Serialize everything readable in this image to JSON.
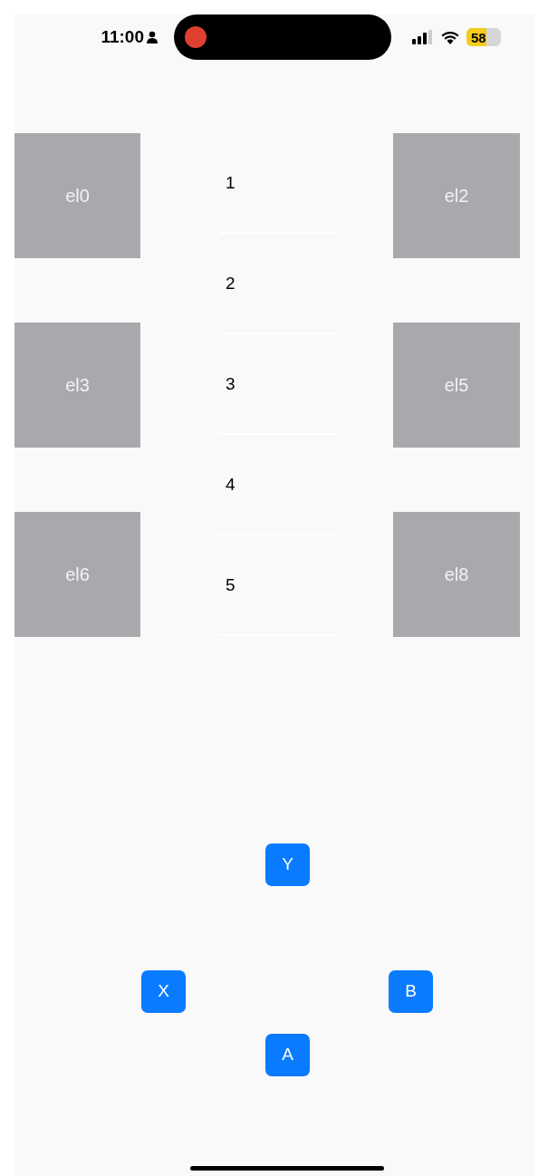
{
  "status_bar": {
    "time": "11:00",
    "battery": "58"
  },
  "tile_rows": [
    {
      "left": "el0",
      "right": "el2"
    },
    {
      "left": "el3",
      "right": "el5"
    },
    {
      "left": "el6",
      "right": "el8"
    }
  ],
  "list_items": [
    "1",
    "2",
    "3",
    "4",
    "5"
  ],
  "pad_buttons": [
    {
      "label": "Y",
      "kind": "top"
    },
    {
      "label": "X",
      "kind": "left"
    },
    {
      "label": "B",
      "kind": "right"
    },
    {
      "label": "A",
      "kind": "bottom"
    }
  ]
}
